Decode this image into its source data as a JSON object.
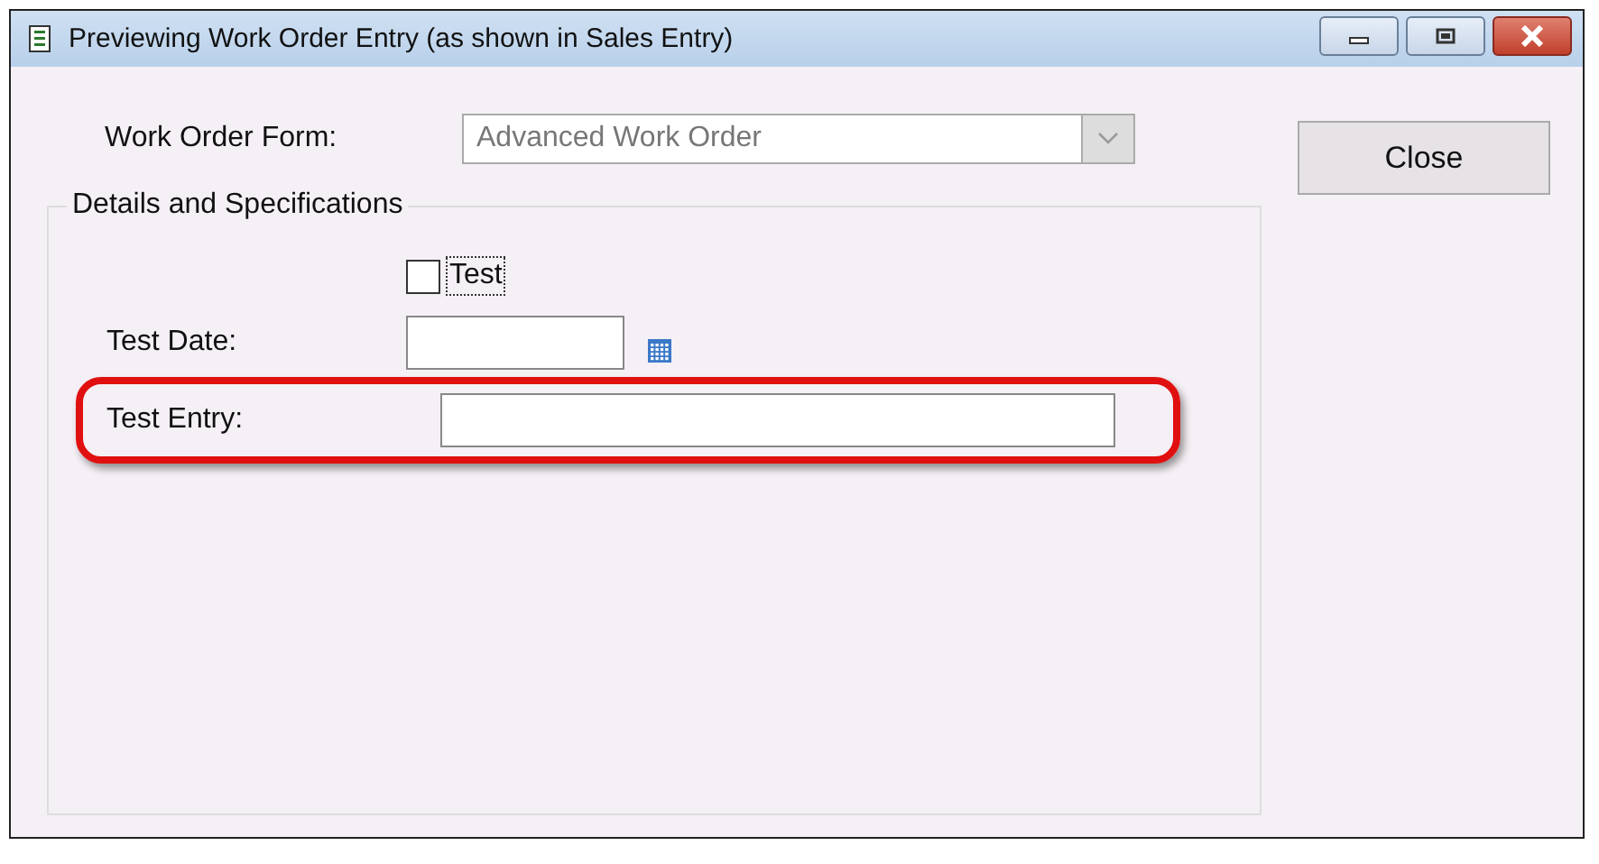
{
  "window": {
    "title": "Previewing Work Order Entry (as shown in Sales Entry)"
  },
  "work_order_form": {
    "label": "Work Order Form:",
    "value": "Advanced Work Order",
    "disabled": true
  },
  "close_button": {
    "label": "Close"
  },
  "group": {
    "title": "Details and Specifications"
  },
  "test_checkbox": {
    "label": "Test",
    "checked": false,
    "focused": true
  },
  "fields": [
    {
      "label": "Test Date:",
      "kind": "date",
      "highlighted": false
    },
    {
      "label": "Test Entry:",
      "kind": "text",
      "highlighted": true
    }
  ]
}
